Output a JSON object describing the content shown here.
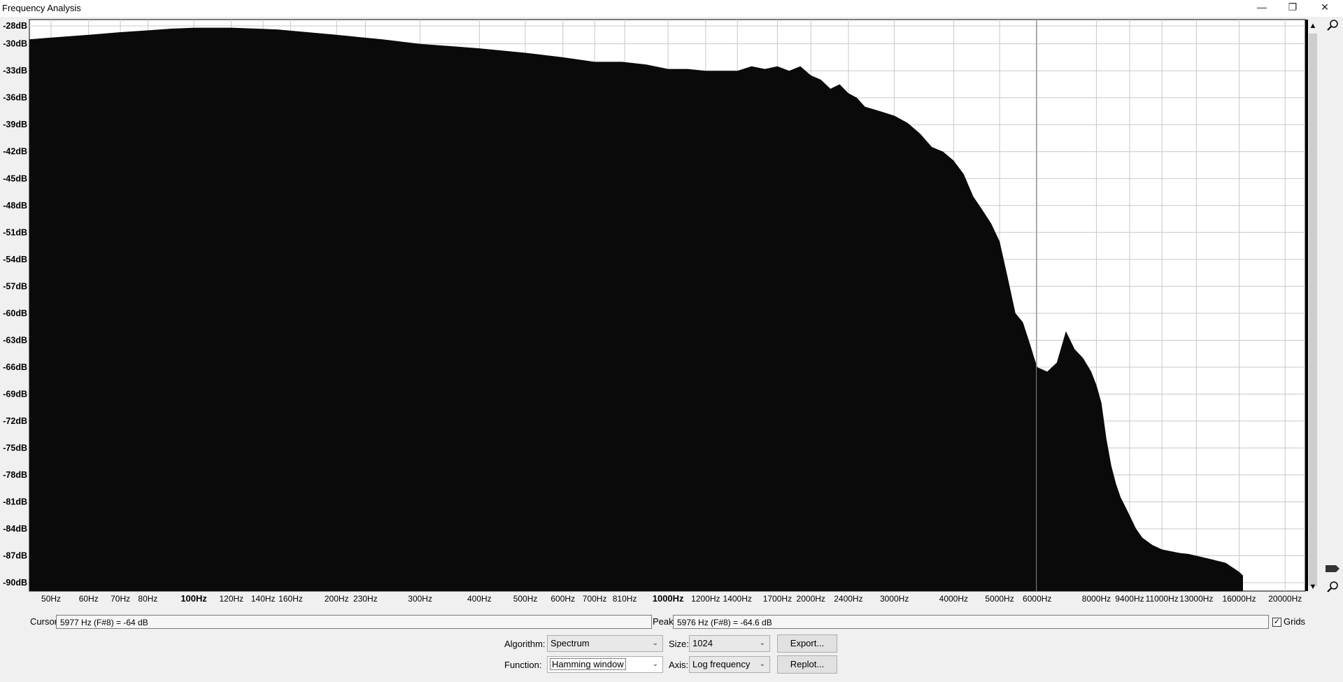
{
  "window": {
    "title": "Frequency Analysis",
    "minimize_icon": "minimize-icon",
    "maximize_icon": "restore-icon",
    "close_icon": "close-icon"
  },
  "chart_data": {
    "type": "area",
    "x_scale": "log",
    "xlim": [
      45,
      22050
    ],
    "ylim": [
      -90,
      -28
    ],
    "grid": true,
    "fill_color": "#0a0a0a",
    "y_ticks": [
      -28,
      -30,
      -33,
      -36,
      -39,
      -42,
      -45,
      -48,
      -51,
      -54,
      -57,
      -60,
      -63,
      -66,
      -69,
      -72,
      -75,
      -78,
      -81,
      -84,
      -87,
      -90
    ],
    "y_tick_labels": [
      "-28dB",
      "-30dB",
      "-33dB",
      "-36dB",
      "-39dB",
      "-42dB",
      "-45dB",
      "-48dB",
      "-51dB",
      "-54dB",
      "-57dB",
      "-60dB",
      "-63dB",
      "-66dB",
      "-69dB",
      "-72dB",
      "-75dB",
      "-78dB",
      "-81dB",
      "-84dB",
      "-87dB",
      "-90dB"
    ],
    "x_ticks": [
      50,
      60,
      70,
      80,
      100,
      120,
      140,
      160,
      200,
      230,
      300,
      400,
      500,
      600,
      700,
      810,
      1000,
      1200,
      1400,
      1700,
      2000,
      2400,
      3000,
      4000,
      5000,
      6000,
      8000,
      9400,
      11000,
      13000,
      16000,
      20000
    ],
    "x_tick_labels": [
      "50Hz",
      "60Hz",
      "70Hz",
      "80Hz",
      "100Hz",
      "120Hz",
      "140Hz",
      "160Hz",
      "200Hz",
      "230Hz",
      "300Hz",
      "400Hz",
      "500Hz",
      "600Hz",
      "700Hz",
      "810Hz",
      "1000Hz",
      "1200Hz",
      "1400Hz",
      "1700Hz",
      "2000Hz",
      "2400Hz",
      "3000Hz",
      "4000Hz",
      "5000Hz",
      "6000Hz",
      "8000Hz",
      "9400Hz",
      "11000Hz",
      "13000Hz",
      "16000Hz",
      "20000Hz"
    ],
    "x_tick_bold": [
      "100Hz",
      "1000Hz"
    ],
    "cursor_freq": 5977,
    "x": [
      45,
      50,
      60,
      70,
      80,
      90,
      100,
      120,
      150,
      200,
      250,
      300,
      400,
      500,
      600,
      700,
      800,
      900,
      1000,
      1100,
      1200,
      1300,
      1400,
      1500,
      1600,
      1700,
      1800,
      1900,
      2000,
      2100,
      2200,
      2300,
      2400,
      2500,
      2600,
      2800,
      3000,
      3200,
      3400,
      3600,
      3800,
      4000,
      4200,
      4400,
      4600,
      4800,
      5000,
      5200,
      5400,
      5600,
      5800,
      6000,
      6300,
      6600,
      6900,
      7200,
      7500,
      7800,
      8000,
      8200,
      8400,
      8600,
      8800,
      9000,
      9200,
      9400,
      9700,
      10000,
      10500,
      11000,
      11500,
      12000,
      12500,
      13000,
      13500,
      14000,
      14500,
      15000,
      15500,
      16000,
      16300
    ],
    "y": [
      -29.5,
      -29.3,
      -29,
      -28.7,
      -28.5,
      -28.3,
      -28.2,
      -28.2,
      -28.4,
      -29,
      -29.5,
      -30,
      -30.5,
      -31,
      -31.5,
      -32,
      -32,
      -32.3,
      -32.8,
      -32.8,
      -33,
      -33,
      -33,
      -32.5,
      -32.8,
      -32.5,
      -33,
      -32.5,
      -33.5,
      -34,
      -35,
      -34.5,
      -35.5,
      -36,
      -37,
      -37.5,
      -38,
      -38.8,
      -40,
      -41.5,
      -42,
      -43,
      -44.5,
      -47,
      -48.5,
      -50,
      -52,
      -56,
      -60,
      -61,
      -63.5,
      -66,
      -66.5,
      -65.5,
      -62,
      -64,
      -65,
      -66.5,
      -68,
      -70,
      -74,
      -77,
      -79,
      -80.5,
      -81.5,
      -82.5,
      -84,
      -85,
      -85.8,
      -86.3,
      -86.5,
      -86.7,
      -86.8,
      -87,
      -87.2,
      -87.4,
      -87.6,
      -87.8,
      -88.3,
      -88.8,
      -89.2
    ]
  },
  "readout": {
    "cursor_label": "Cursor:",
    "cursor_value": "5977 Hz (F#8) = -64 dB",
    "peak_label": "Peak:",
    "peak_value": "5976 Hz (F#8) = -64.6 dB",
    "grids_label": "Grids",
    "grids_checked": true
  },
  "controls": {
    "algorithm_label": "Algorithm:",
    "algorithm_value": "Spectrum",
    "size_label": "Size:",
    "size_value": "1024",
    "export_label": "Export...",
    "function_label": "Function:",
    "function_value": "Hamming window",
    "axis_label": "Axis:",
    "axis_value": "Log frequency",
    "replot_label": "Replot..."
  }
}
